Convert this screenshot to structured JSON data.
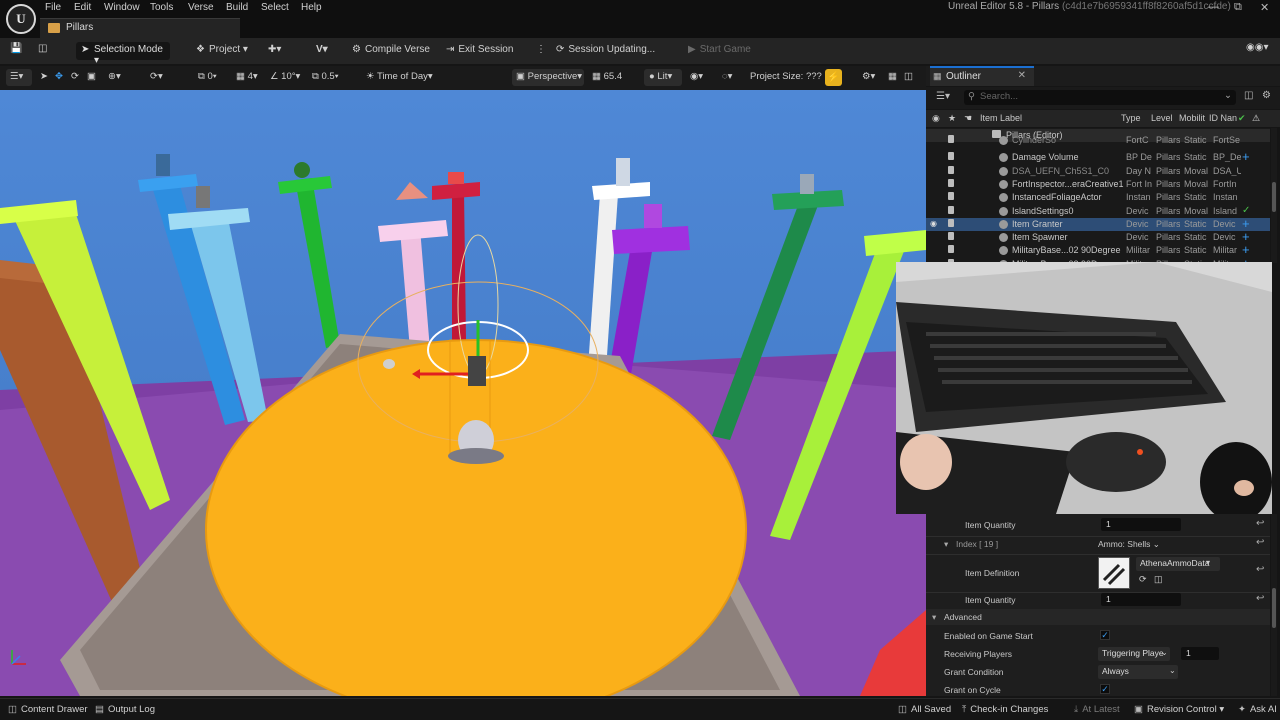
{
  "app": {
    "menus": [
      "File",
      "Edit",
      "Window",
      "Tools",
      "Verse",
      "Build",
      "Select",
      "Help"
    ],
    "map_tab": "Pillars",
    "window_title": "Unreal Editor 5.8 - Pillars",
    "window_hash": "(c4d1e7b6959341ff8f8260af5d1ccfde)"
  },
  "toolbar": {
    "selection_mode": "Selection Mode",
    "project": "Project",
    "compile_verse": "Compile Verse",
    "exit_session": "Exit Session",
    "session_updating": "Session Updating...",
    "start_game": "Start Game"
  },
  "viewport_toolbar": {
    "rotate_snap_count": "0",
    "scale_count": "4",
    "angle": "10°",
    "scale_snap": "0.5",
    "time_of_day": "Time of Day",
    "perspective": "Perspective",
    "fov": "65.4",
    "lit": "Lit",
    "project_size": "Project Size: ???"
  },
  "outliner": {
    "tab": "Outliner",
    "search_placeholder": "Search...",
    "columns": {
      "label": "Item Label",
      "type": "Type",
      "level": "Level",
      "mobility": "Mobilit",
      "id": "ID Nan"
    },
    "root": "Pillars (Editor)",
    "rows": [
      {
        "label": "CylinderSo",
        "type": "FortC",
        "level": "Pillars",
        "mob": "Static",
        "id": "FortSe",
        "mark": "",
        "dim": true,
        "partial": true
      },
      {
        "label": "Damage Volume",
        "type": "BP De",
        "level": "Pillars",
        "mob": "Static",
        "id": "BP_De",
        "mark": "+",
        "dim": false
      },
      {
        "label": "DSA_UEFN_Ch5S1_C0",
        "type": "Day N",
        "level": "Pillars",
        "mob": "Moval",
        "id": "DSA_U",
        "mark": "",
        "dim": true
      },
      {
        "label": "FortInspector...eraCreative1",
        "type": "Fort In",
        "level": "Pillars",
        "mob": "Moval",
        "id": "FortIn",
        "mark": "",
        "dim": false
      },
      {
        "label": "InstancedFoliageActor",
        "type": "Instan",
        "level": "Pillars",
        "mob": "Static",
        "id": "Instan",
        "mark": "",
        "dim": false
      },
      {
        "label": "IslandSettings0",
        "type": "Devic",
        "level": "Pillars",
        "mob": "Moval",
        "id": "Island",
        "mark": "✓",
        "dim": false
      },
      {
        "label": "Item Granter",
        "type": "Devic",
        "level": "Pillars",
        "mob": "Static",
        "id": "Devic",
        "mark": "+",
        "dim": false,
        "selected": true
      },
      {
        "label": "Item Spawner",
        "type": "Devic",
        "level": "Pillars",
        "mob": "Static",
        "id": "Devic",
        "mark": "+",
        "dim": false
      },
      {
        "label": "MilitaryBase...02 90Degree",
        "type": "Militar",
        "level": "Pillars",
        "mob": "Static",
        "id": "Militar",
        "mark": "+",
        "dim": false
      },
      {
        "label": "MilitaryBase...02 90Degree",
        "type": "Militar",
        "level": "Pillars",
        "mob": "Static",
        "id": "Militar",
        "mark": "+",
        "dim": false,
        "partial": true
      }
    ]
  },
  "details": {
    "item_quantity_label": "Item Quantity",
    "item_quantity_1": "1",
    "index_label": "Index [ 19 ]",
    "index_value": "Ammo: Shells",
    "item_definition_label": "Item Definition",
    "item_definition_value": "AthenaAmmoData",
    "item_quantity_2": "1",
    "advanced": "Advanced",
    "enabled_on_game_start": "Enabled on Game Start",
    "receiving_players": "Receiving Players",
    "receiving_value": "Triggering Playe",
    "receiving_num": "1",
    "grant_condition": "Grant Condition",
    "grant_condition_value": "Always",
    "grant_on_cycle": "Grant on Cycle"
  },
  "statusbar": {
    "content_drawer": "Content Drawer",
    "output_log": "Output Log",
    "all_saved": "All Saved",
    "check_in": "Check-in Changes",
    "at_latest": "At Latest",
    "revision_control": "Revision Control",
    "ask_ai": "Ask AI"
  }
}
